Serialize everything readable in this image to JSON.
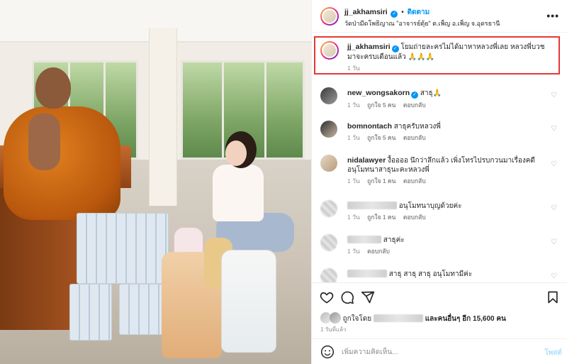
{
  "post": {
    "username": "jj_akhamsiri",
    "follow_label": "ติดตาม",
    "separator": "•",
    "location": "วัดป่ามีดโพธิญาณ \"อาจารย์ตุ้ย\" ต.เพ็ญ อ.เพ็ญ จ.อุดรธานี",
    "more_icon": "more-horizontal-icon"
  },
  "caption": {
    "username": "jj_akhamsiri",
    "text": "โยมถ่ายละครไม่ได้มาหาหลวงพี่เลย หลวงพี่บวชมาจะครบเดือนแล้ว 🙏🙏🙏",
    "time": "1 วัน"
  },
  "comments": [
    {
      "username": "new_wongsakorn",
      "verified": true,
      "text": "สาธุ🙏",
      "time": "1 วัน",
      "likes": "ถูกใจ 5 คน",
      "reply": "ตอบกลับ"
    },
    {
      "username": "bomnontach",
      "verified": false,
      "text": "สาธุครับหลวงพี่",
      "time": "1 วัน",
      "likes": "ถูกใจ 5 คน",
      "reply": "ตอบกลับ"
    },
    {
      "username": "nidalawyer",
      "verified": false,
      "text": "งื้ออออ นึกว่าลึกแล้ว เพิ่งโทรไปรบกวนมาเรื่องคดี อนุโมทนาสาธุนะคะหลวงพี่",
      "time": "1 วัน",
      "likes": "ถูกใจ 1 คน",
      "reply": "ตอบกลับ"
    },
    {
      "username": "",
      "verified": false,
      "text": "อนุโมทนาบุญด้วยค่ะ",
      "time": "1 วัน",
      "likes": "ถูกใจ 1 คน",
      "reply": "ตอบกลับ"
    },
    {
      "username": "",
      "verified": false,
      "text": "สาธุค่ะ",
      "time": "1 วัน",
      "likes": "",
      "reply": "ตอบกลับ"
    },
    {
      "username": "",
      "verified": false,
      "text": "สาธุ สาธุ สาธุ อนุโมทามีค่ะ",
      "time": "",
      "likes": "",
      "reply": ""
    }
  ],
  "actions": {
    "like_icon": "heart-icon",
    "comment_icon": "comment-icon",
    "share_icon": "send-icon",
    "save_icon": "bookmark-icon"
  },
  "likes_text_prefix": "ถูกใจโดย",
  "likes_text_suffix": "และคนอื่นๆ อีก 15,600 คน",
  "post_time": "1 วันที่แล้ว",
  "comment_box": {
    "placeholder": "เพิ่มความคิดเห็น...",
    "post_label": "โพสต์"
  },
  "colors": {
    "accent": "#0095f6",
    "highlight_border": "#e53935",
    "muted": "#8e8e8e"
  }
}
